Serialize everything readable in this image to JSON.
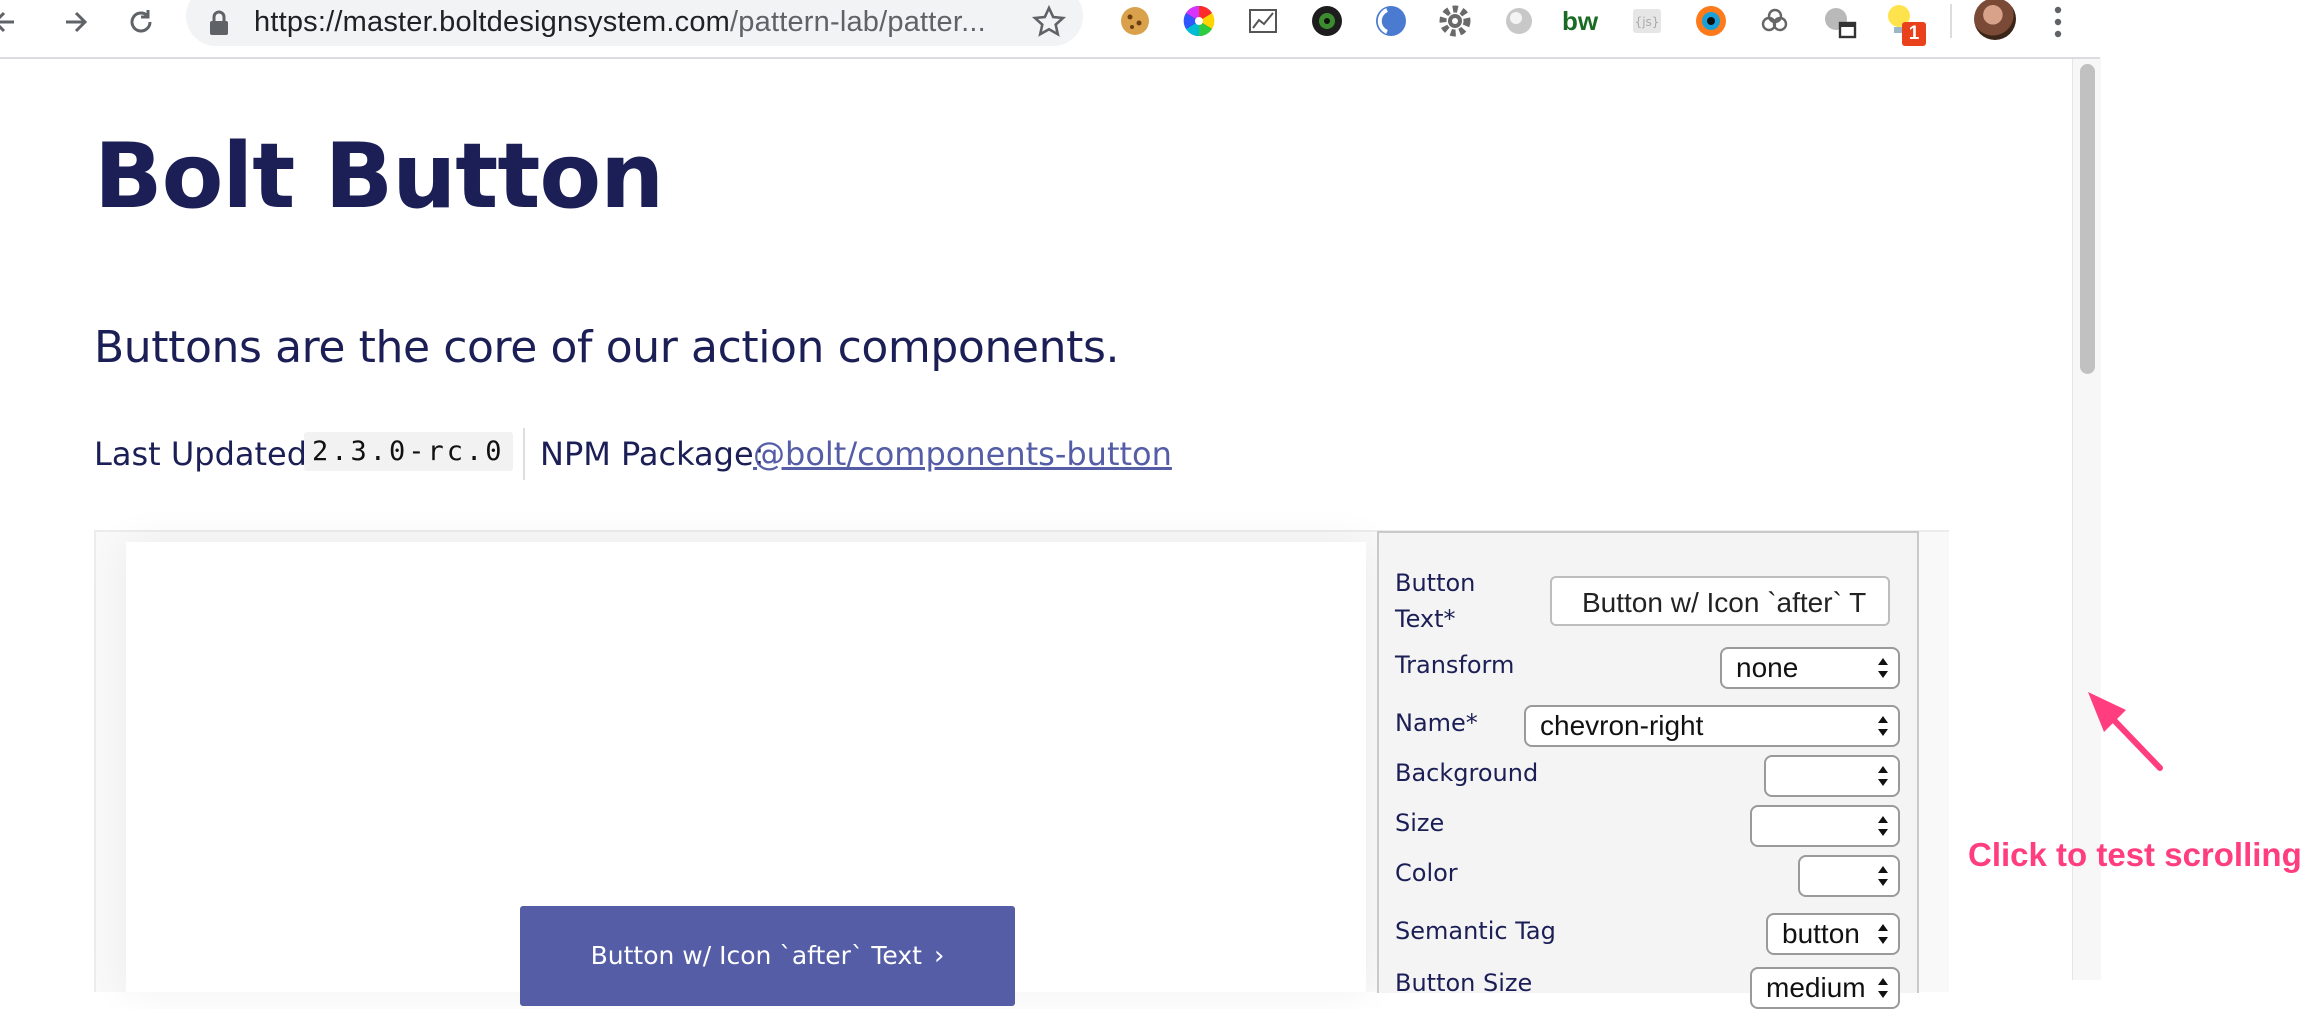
{
  "browser": {
    "url_host": "https://master.boltdesignsystem.com",
    "url_path": "/pattern-lab/patter...",
    "extension_badge": "1",
    "extension_bw_text": "bw"
  },
  "page": {
    "title": "Bolt Button",
    "lede": "Buttons are the core of our action components.",
    "last_updated_label": "Last Updated:",
    "version": "2.3.0-rc.0",
    "npm_label": "NPM Package:",
    "npm_link": "@bolt/components-button"
  },
  "demo": {
    "button_label": "Button w/ Icon `after` Text",
    "button_chevron": "›"
  },
  "panel": {
    "fields": [
      {
        "label": "Button",
        "label2": "Text*",
        "value": "Button w/ Icon `after` T"
      },
      {
        "label": "Transform",
        "value": "none"
      },
      {
        "label": "Name*",
        "value": "chevron-right"
      },
      {
        "label": "Background",
        "value": ""
      },
      {
        "label": "Size",
        "value": ""
      },
      {
        "label": "Color",
        "value": ""
      },
      {
        "label": "Semantic Tag",
        "value": "button"
      },
      {
        "label": "Button Size",
        "value": "medium"
      }
    ]
  },
  "annotation": {
    "text": "Click to test scrolling",
    "color": "#ff3d7f"
  },
  "colors": {
    "brand": "#1b1f56",
    "button": "#545da6",
    "link": "#545da6"
  }
}
